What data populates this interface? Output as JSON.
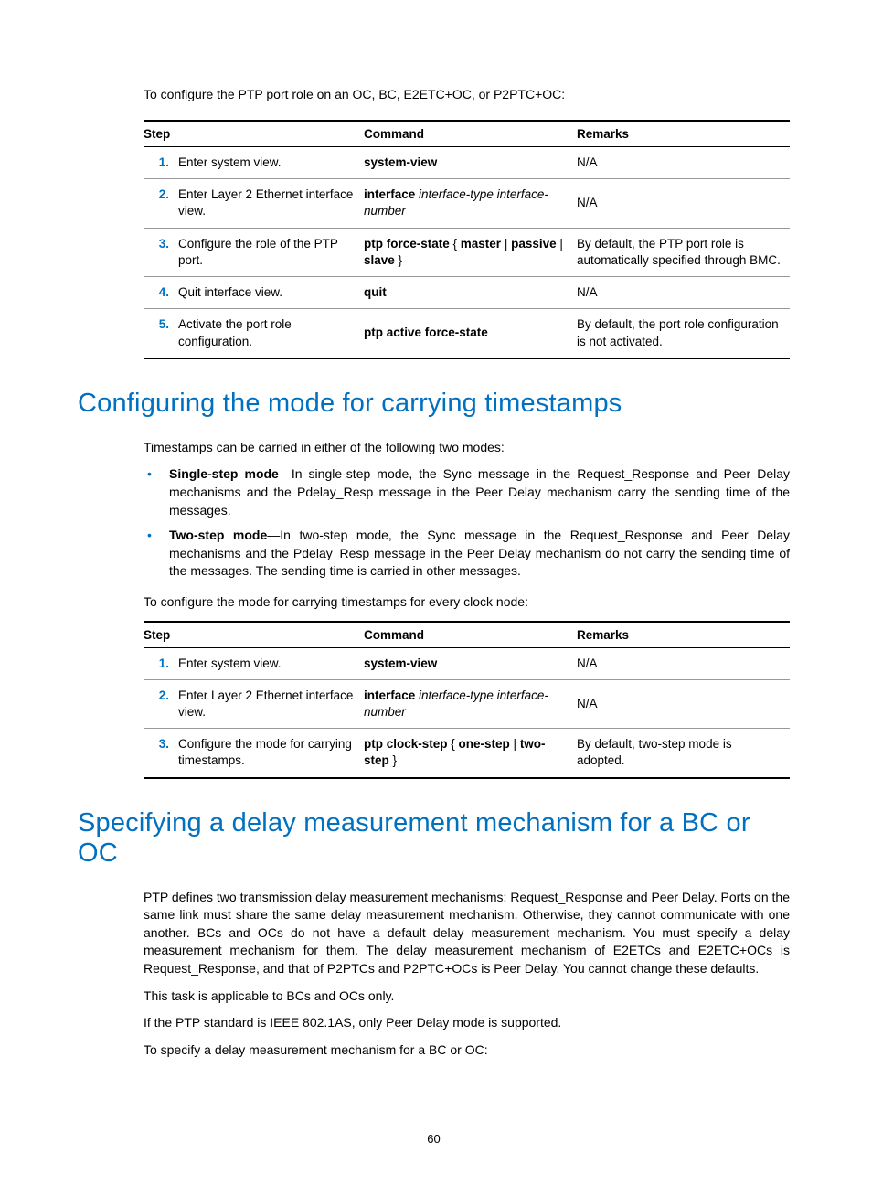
{
  "intro1": "To configure the PTP port role on an OC, BC, E2ETC+OC, or P2PTC+OC:",
  "table1": {
    "headers": {
      "step": "Step",
      "command": "Command",
      "remarks": "Remarks"
    },
    "rows": [
      {
        "num": "1.",
        "desc": "Enter system view.",
        "cmd_bold": "system-view",
        "cmd_italic": "",
        "remarks": "N/A"
      },
      {
        "num": "2.",
        "desc": "Enter Layer 2 Ethernet interface view.",
        "cmd_bold": "interface ",
        "cmd_italic": "interface-type interface-number",
        "remarks": "N/A"
      },
      {
        "num": "3.",
        "desc": "Configure the role of the PTP port.",
        "cmd_bold": "ptp force-state",
        "cmd_mid": " { ",
        "cmd_opt1": "master",
        "cmd_sep1": " | ",
        "cmd_opt2": "passive",
        "cmd_sep2": " | ",
        "cmd_opt3": "slave",
        "cmd_end": " }",
        "remarks": "By default, the PTP port role is automatically specified through BMC."
      },
      {
        "num": "4.",
        "desc": "Quit interface view.",
        "cmd_bold": "quit",
        "cmd_italic": "",
        "remarks": "N/A"
      },
      {
        "num": "5.",
        "desc": "Activate the port role configuration.",
        "cmd_bold": "ptp active force-state",
        "cmd_italic": "",
        "remarks": "By default, the port role configuration is not activated."
      }
    ]
  },
  "h2_1": "Configuring the mode for carrying timestamps",
  "para1": "Timestamps can be carried in either of the following two modes:",
  "bullet1_label": "Single-step mode",
  "bullet1_rest": "—In single-step mode, the Sync message in the Request_Response and Peer Delay mechanisms and the Pdelay_Resp message in the Peer Delay mechanism carry the sending time of the messages.",
  "bullet2_label": "Two-step mode",
  "bullet2_rest": "—In two-step mode, the Sync message in the Request_Response and Peer Delay mechanisms and the Pdelay_Resp message in the Peer Delay mechanism do not carry the sending time of the messages. The sending time is carried in other messages.",
  "para2": "To configure the mode for carrying timestamps for every clock node:",
  "table2": {
    "headers": {
      "step": "Step",
      "command": "Command",
      "remarks": "Remarks"
    },
    "rows": [
      {
        "num": "1.",
        "desc": "Enter system view.",
        "cmd_bold": "system-view",
        "cmd_italic": "",
        "remarks": "N/A"
      },
      {
        "num": "2.",
        "desc": "Enter Layer 2 Ethernet interface view.",
        "cmd_bold": "interface ",
        "cmd_italic": "interface-type interface-number",
        "remarks": "N/A"
      },
      {
        "num": "3.",
        "desc": "Configure the mode for carrying timestamps.",
        "cmd_bold": "ptp clock-step",
        "cmd_mid": " { ",
        "cmd_opt1": "one-step",
        "cmd_sep1": " | ",
        "cmd_opt2": "two-step",
        "cmd_end": " }",
        "remarks": "By default, two-step mode is adopted."
      }
    ]
  },
  "h2_2": "Specifying a delay measurement mechanism for a BC or OC",
  "para3": "PTP defines two transmission delay measurement mechanisms: Request_Response and Peer Delay. Ports on the same link must share the same delay measurement mechanism. Otherwise, they cannot communicate with one another. BCs and OCs do not have a default delay measurement mechanism. You must specify a delay measurement mechanism for them. The delay measurement mechanism of E2ETCs and E2ETC+OCs is Request_Response, and that of P2PTCs and P2PTC+OCs is Peer Delay. You cannot change these defaults.",
  "para4": "This task is applicable to BCs and OCs only.",
  "para5": "If the PTP standard is IEEE 802.1AS, only Peer Delay mode is supported.",
  "para6": "To specify a delay measurement mechanism for a BC or OC:",
  "page_num": "60"
}
